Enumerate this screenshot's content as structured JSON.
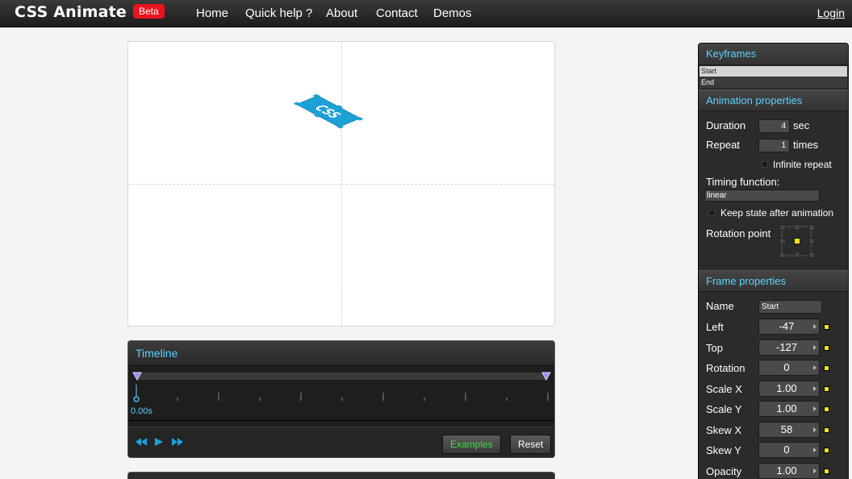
{
  "header": {
    "brand": "CSS Animate",
    "badge": "Beta",
    "nav": [
      "Home",
      "Quick help ?",
      "About",
      "Contact",
      "Demos"
    ],
    "login": "Login"
  },
  "stage": {
    "sample_text": "CSS",
    "sample_color": "#1ba1d5"
  },
  "timeline": {
    "title": "Timeline",
    "current_time": "0.00s",
    "examples_label": "Examples",
    "reset_label": "Reset",
    "accent": "#5bd2ff",
    "examples_color": "#3ddc45"
  },
  "panel": {
    "keyframes_title": "Keyframes",
    "keyframes": [
      "Start",
      "End"
    ],
    "animation_title": "Animation properties",
    "duration_label": "Duration",
    "duration_value": "4",
    "duration_unit": "sec",
    "repeat_label": "Repeat",
    "repeat_value": "1",
    "repeat_unit": "times",
    "infinite_label": "Infinite repeat",
    "timing_label": "Timing function:",
    "timing_value": "linear",
    "keep_state_label": "Keep state after animation",
    "rotation_point_label": "Rotation point",
    "frame_title": "Frame properties",
    "name_label": "Name",
    "name_value": "Start",
    "props": [
      {
        "label": "Left",
        "value": "-47"
      },
      {
        "label": "Top",
        "value": "-127"
      },
      {
        "label": "Rotation",
        "value": "0"
      },
      {
        "label": "Scale X",
        "value": "1.00"
      },
      {
        "label": "Scale Y",
        "value": "1.00"
      },
      {
        "label": "Skew X",
        "value": "58"
      },
      {
        "label": "Skew Y",
        "value": "0"
      },
      {
        "label": "Opacity",
        "value": "1.00"
      }
    ]
  }
}
